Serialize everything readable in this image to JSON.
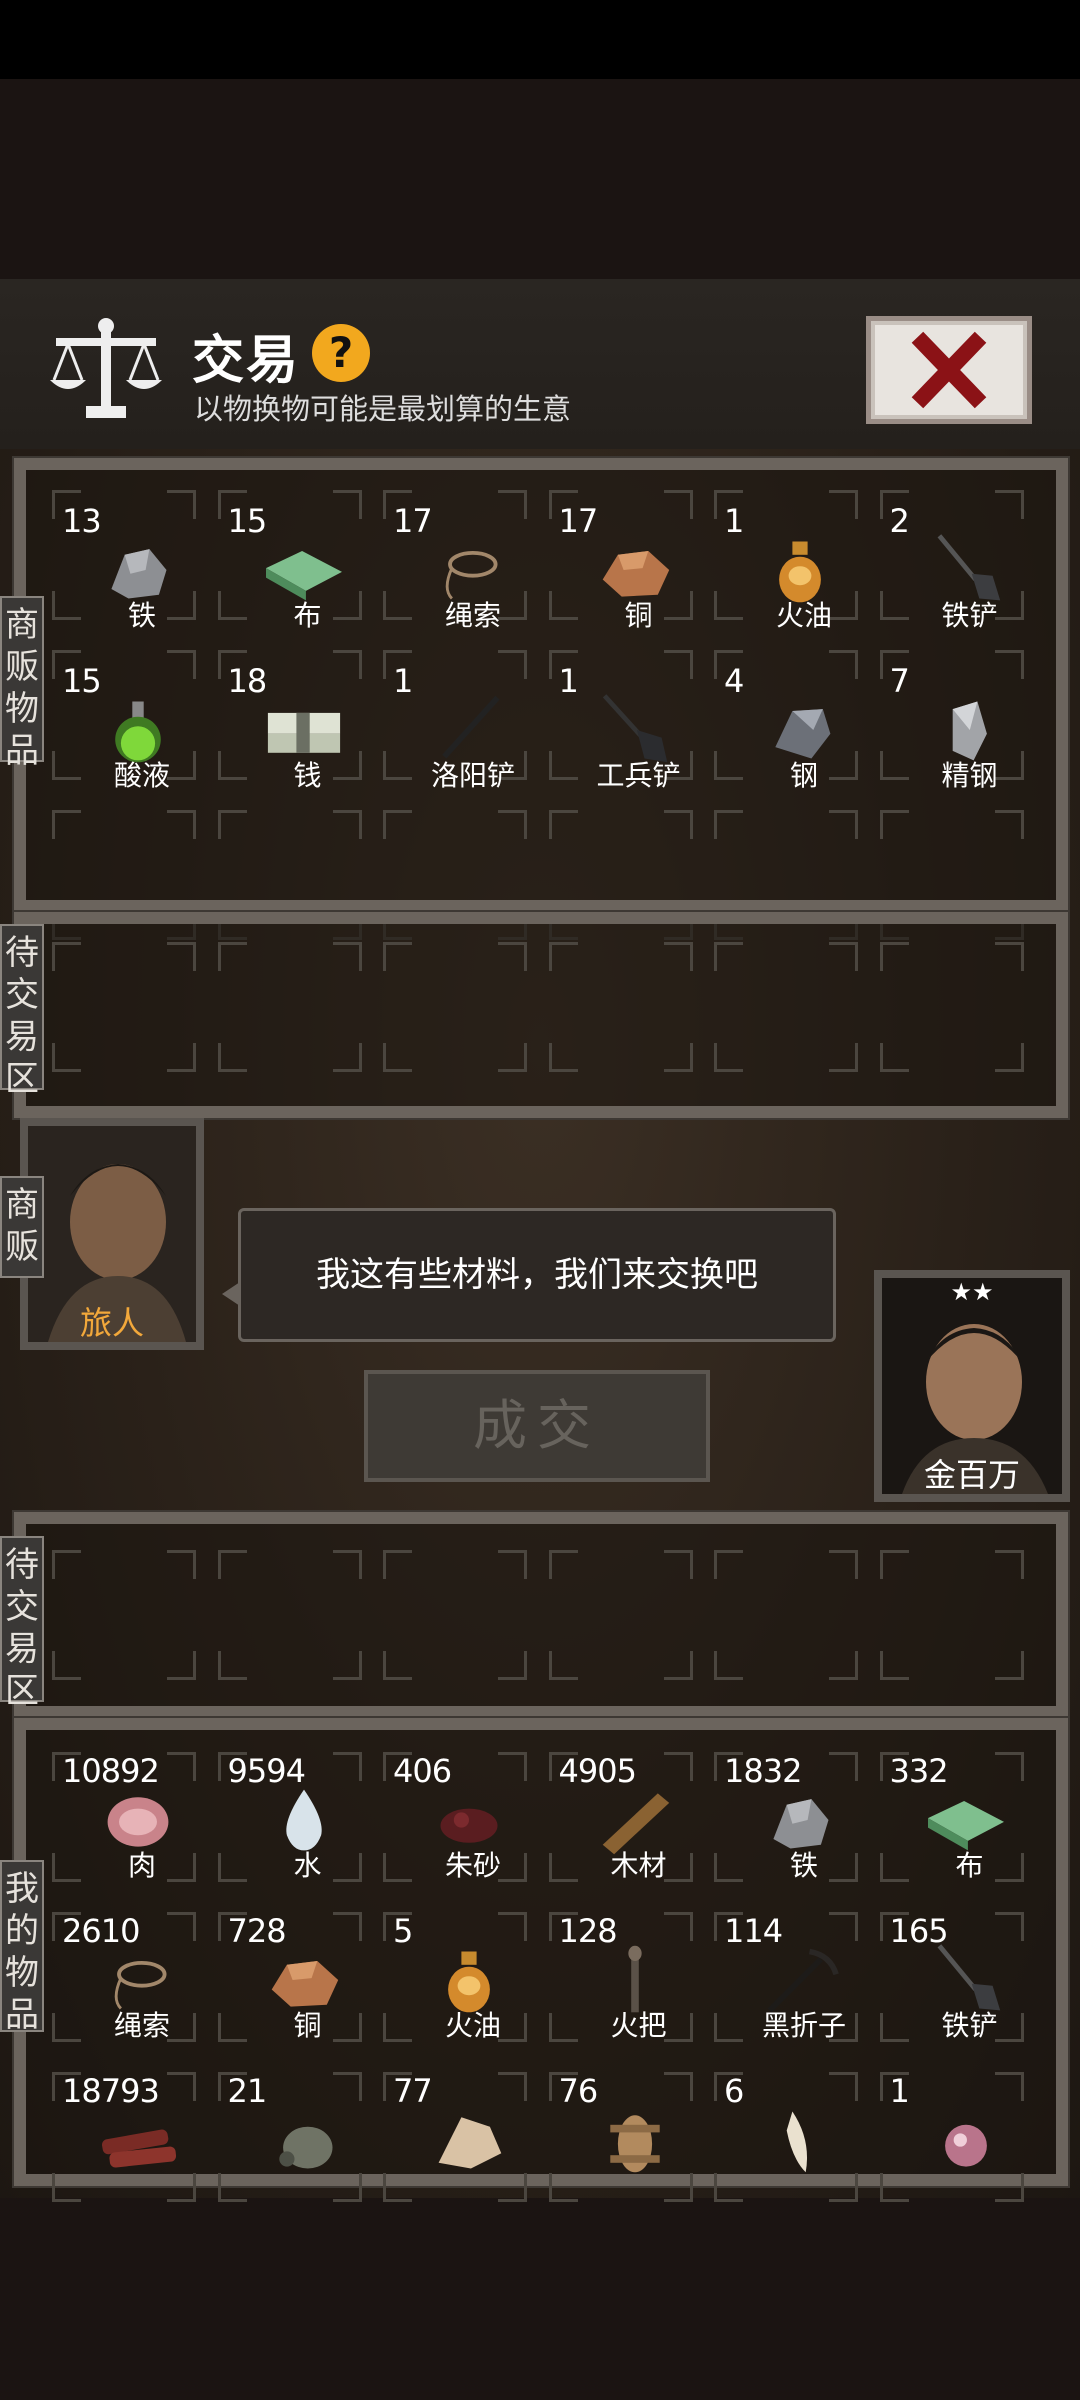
{
  "header": {
    "title": "交易",
    "subtitle": "以物换物可能是最划算的生意",
    "help_label": "?"
  },
  "tabs": {
    "merchant_goods": "商贩物品",
    "pending_top": "待交易区",
    "merchant": "商贩",
    "pending_bottom": "待交易区",
    "my_goods": "我的物品"
  },
  "merchant_items": [
    {
      "qty": "13",
      "name": "铁",
      "icon": "iron-ore-icon"
    },
    {
      "qty": "15",
      "name": "布",
      "icon": "cloth-icon"
    },
    {
      "qty": "17",
      "name": "绳索",
      "icon": "rope-icon"
    },
    {
      "qty": "17",
      "name": "铜",
      "icon": "copper-ore-icon"
    },
    {
      "qty": "1",
      "name": "火油",
      "icon": "fire-oil-icon"
    },
    {
      "qty": "2",
      "name": "铁铲",
      "icon": "iron-shovel-icon"
    },
    {
      "qty": "15",
      "name": "酸液",
      "icon": "acid-flask-icon"
    },
    {
      "qty": "18",
      "name": "钱",
      "icon": "money-stack-icon"
    },
    {
      "qty": "1",
      "name": "洛阳铲",
      "icon": "luoyang-shovel-icon"
    },
    {
      "qty": "1",
      "name": "工兵铲",
      "icon": "engineer-shovel-icon"
    },
    {
      "qty": "4",
      "name": "钢",
      "icon": "steel-icon"
    },
    {
      "qty": "7",
      "name": "精钢",
      "icon": "refined-steel-icon"
    }
  ],
  "merchant": {
    "name": "旅人",
    "dialog": "我这有些材料，我们来交换吧"
  },
  "player": {
    "name": "金百万",
    "stars": "★★"
  },
  "deal_button": "成交",
  "my_items": [
    {
      "qty": "10892",
      "name": "肉",
      "icon": "meat-icon"
    },
    {
      "qty": "9594",
      "name": "水",
      "icon": "water-drop-icon"
    },
    {
      "qty": "406",
      "name": "朱砂",
      "icon": "cinnabar-icon"
    },
    {
      "qty": "4905",
      "name": "木材",
      "icon": "wood-icon"
    },
    {
      "qty": "1832",
      "name": "铁",
      "icon": "iron-ore-icon"
    },
    {
      "qty": "332",
      "name": "布",
      "icon": "cloth-icon"
    },
    {
      "qty": "2610",
      "name": "绳索",
      "icon": "rope-icon"
    },
    {
      "qty": "728",
      "name": "铜",
      "icon": "copper-ore-icon"
    },
    {
      "qty": "5",
      "name": "火油",
      "icon": "fire-oil-icon"
    },
    {
      "qty": "128",
      "name": "火把",
      "icon": "torch-icon"
    },
    {
      "qty": "114",
      "name": "黑折子",
      "icon": "black-pickaxe-icon"
    },
    {
      "qty": "165",
      "name": "铁铲",
      "icon": "iron-shovel-icon"
    },
    {
      "qty": "18793",
      "name": "",
      "icon": "jerky-icon"
    },
    {
      "qty": "21",
      "name": "",
      "icon": "gourd-icon"
    },
    {
      "qty": "77",
      "name": "",
      "icon": "bone-icon"
    },
    {
      "qty": "76",
      "name": "",
      "icon": "pelt-icon"
    },
    {
      "qty": "6",
      "name": "",
      "icon": "fang-icon"
    },
    {
      "qty": "1",
      "name": "",
      "icon": "pearl-icon"
    }
  ]
}
